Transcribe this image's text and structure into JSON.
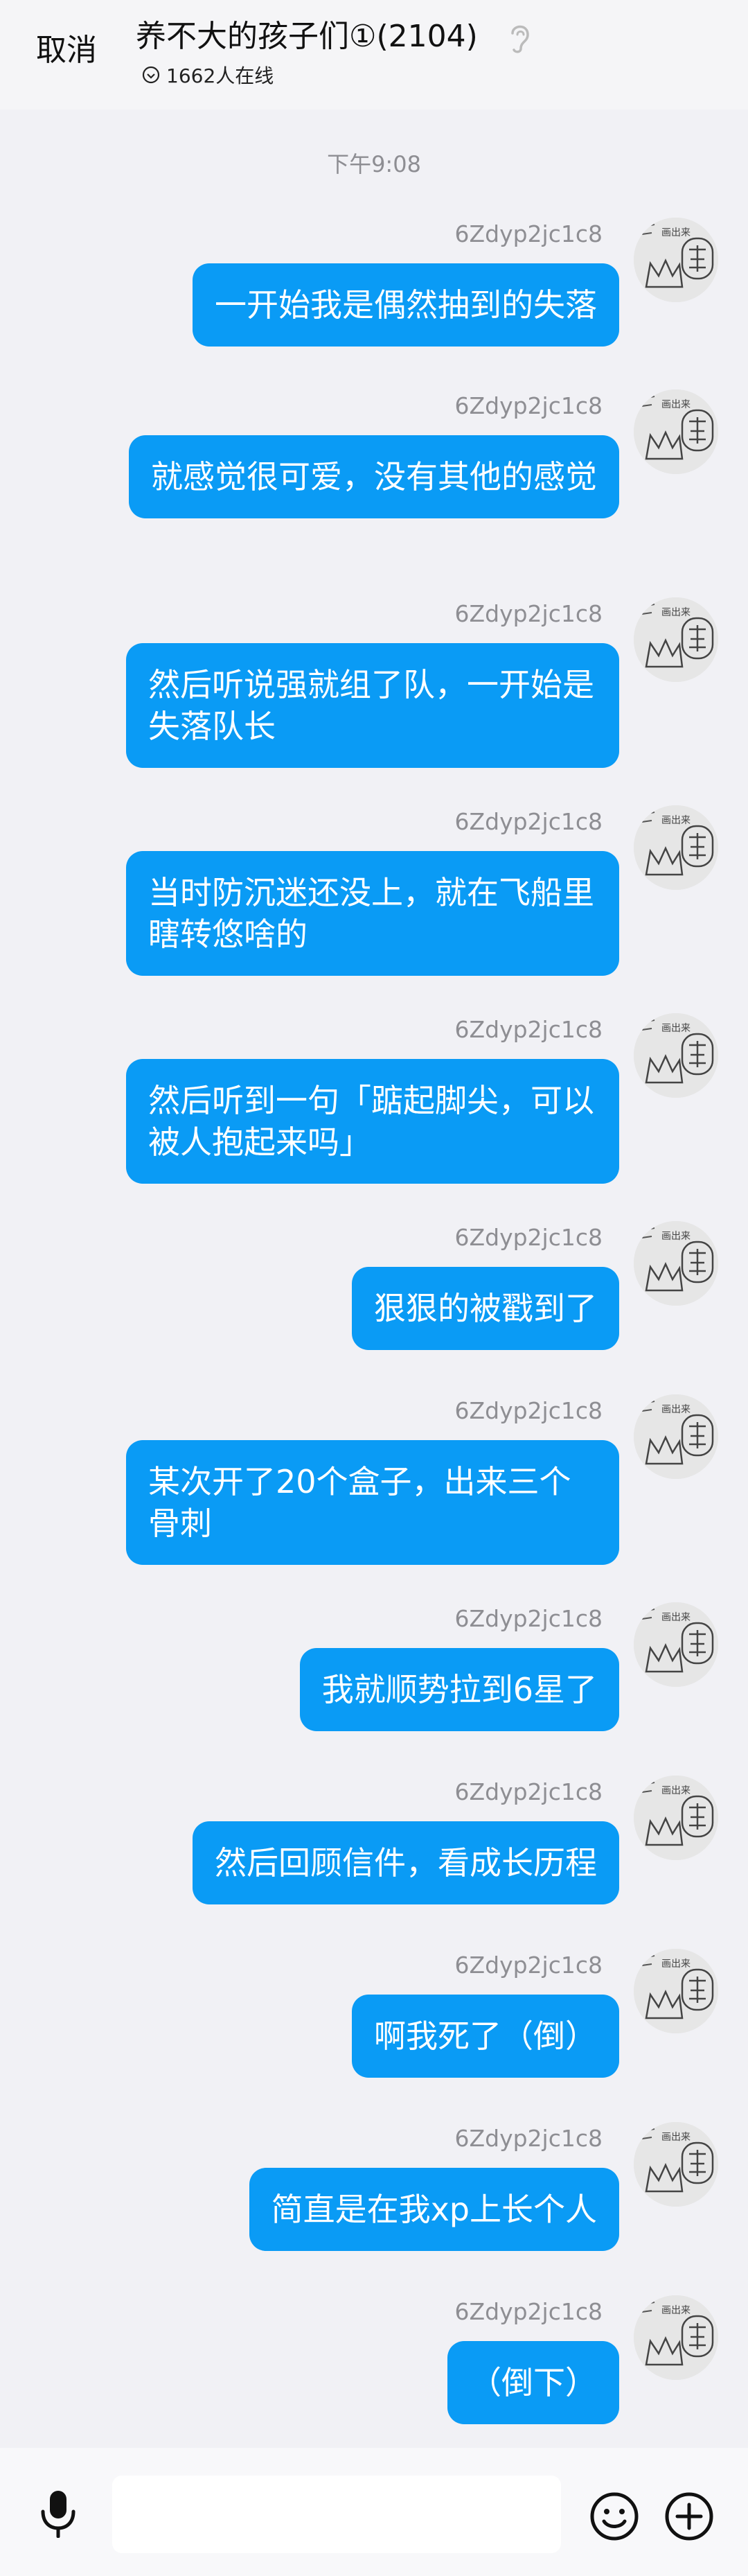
{
  "header": {
    "cancel_label": "取消",
    "title": "养不大的孩子们①(2104)",
    "online_text": "1662人在线"
  },
  "timestamp": "下午9:08",
  "messages": [
    {
      "nick": "6Zdyp2jc1c8",
      "text": "一开始我是偶然抽到的失落"
    },
    {
      "nick": "6Zdyp2jc1c8",
      "text": "就感觉很可爱，没有其他的感觉"
    },
    {
      "nick": "6Zdyp2jc1c8",
      "text": "然后听说强就组了队，一开始是失落队长"
    },
    {
      "nick": "6Zdyp2jc1c8",
      "text": "当时防沉迷还没上，就在飞船里瞎转悠啥的"
    },
    {
      "nick": "6Zdyp2jc1c8",
      "text": "然后听到一句「踮起脚尖，可以被人抱起来吗」"
    },
    {
      "nick": "6Zdyp2jc1c8",
      "text": "狠狠的被戳到了"
    },
    {
      "nick": "6Zdyp2jc1c8",
      "text": "某次开了20个盒子，出来三个骨刺"
    },
    {
      "nick": "6Zdyp2jc1c8",
      "text": "我就顺势拉到6星了"
    },
    {
      "nick": "6Zdyp2jc1c8",
      "text": "然后回顾信件，看成长历程"
    },
    {
      "nick": "6Zdyp2jc1c8",
      "text": "啊我死了（倒）"
    },
    {
      "nick": "6Zdyp2jc1c8",
      "text": "简直是在我xp上长个人"
    },
    {
      "nick": "6Zdyp2jc1c8",
      "text": "（倒下）"
    }
  ],
  "avatar_text": "画出来",
  "colors": {
    "bubble": "#0a9bf5",
    "background": "#f1f1f5"
  },
  "icons": [
    "ear-icon",
    "check-circle-icon",
    "mic-icon",
    "emoji-icon",
    "plus-icon"
  ]
}
